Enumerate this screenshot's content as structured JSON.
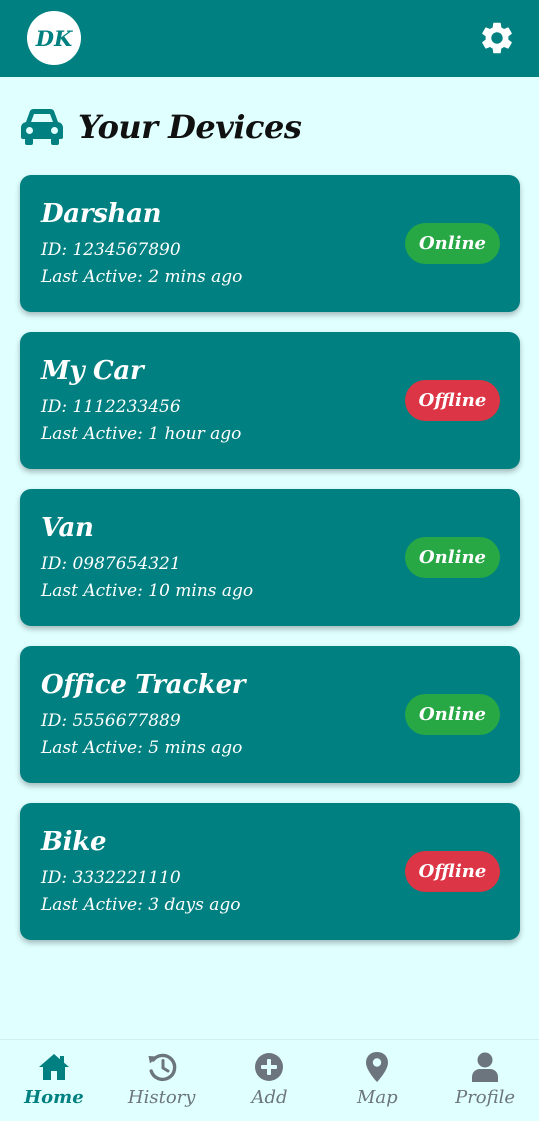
{
  "header": {
    "avatar_initials": "DK"
  },
  "page": {
    "title": "Your Devices"
  },
  "colors": {
    "primary": "#008080",
    "background": "#e0ffff",
    "online": "#28a745",
    "offline": "#dc3545",
    "nav_inactive": "#6c757d"
  },
  "devices": [
    {
      "name": "Darshan",
      "id_label": "ID:",
      "id": "1234567890",
      "last_active_label": "Last Active:",
      "last_active": "2 mins ago",
      "status": "Online"
    },
    {
      "name": "My Car",
      "id_label": "ID:",
      "id": "1112233456",
      "last_active_label": "Last Active:",
      "last_active": "1 hour ago",
      "status": "Offline"
    },
    {
      "name": "Van",
      "id_label": "ID:",
      "id": "0987654321",
      "last_active_label": "Last Active:",
      "last_active": "10 mins ago",
      "status": "Online"
    },
    {
      "name": "Office Tracker",
      "id_label": "ID:",
      "id": "5556677889",
      "last_active_label": "Last Active:",
      "last_active": "5 mins ago",
      "status": "Online"
    },
    {
      "name": "Bike",
      "id_label": "ID:",
      "id": "3332221110",
      "last_active_label": "Last Active:",
      "last_active": "3 days ago",
      "status": "Offline"
    }
  ],
  "nav": [
    {
      "label": "Home",
      "icon": "home-icon",
      "active": true
    },
    {
      "label": "History",
      "icon": "history-icon",
      "active": false
    },
    {
      "label": "Add",
      "icon": "add-circle-icon",
      "active": false
    },
    {
      "label": "Map",
      "icon": "map-pin-icon",
      "active": false
    },
    {
      "label": "Profile",
      "icon": "user-icon",
      "active": false
    }
  ]
}
